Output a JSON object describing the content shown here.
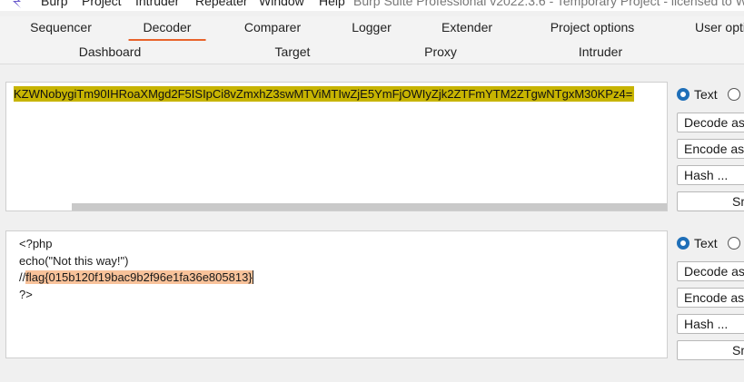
{
  "menubar": {
    "items": [
      "Burp",
      "Project",
      "Intruder",
      "Repeater",
      "Window",
      "Help"
    ],
    "window_title": "Burp Suite Professional v2022.3.6 - Temporary Project - licensed to W"
  },
  "tabs_row1": [
    "Sequencer",
    "Decoder",
    "Comparer",
    "Logger",
    "Extender",
    "Project options",
    "User opti"
  ],
  "tabs_row2": [
    "Dashboard",
    "Target",
    "Proxy",
    "Intruder"
  ],
  "selected_tab": "Decoder",
  "colors": {
    "accent": "#e8632b",
    "input_highlight": "#c7b401",
    "output_highlight": "#f8c29a",
    "radio": "#1f6fb8"
  },
  "panel1": {
    "content": "KZWNobygiTm90IHRoaXMgd2F5ISIpCi8vZmxhZ3swMTViMTIwZjE5YmFjOWIyZjk2ZTFmYTM2ZTgwNTgxM30KPz4="
  },
  "panel2": {
    "lines": [
      "<?php",
      "echo(\"Not this way!\")"
    ],
    "comment_prefix": "//",
    "flag": "flag{015b120f19bac9b2f96e1fa36e805813}",
    "last_line": "?>"
  },
  "controls1": {
    "radio_text": "Text",
    "decode_as": "Decode as ...",
    "encode_as": "Encode as ...",
    "hash": "Hash ...",
    "smart_decode": "Smart decode"
  },
  "controls2": {
    "radio_text": "Text",
    "decode_as": "Decode as ...",
    "encode_as": "Encode as ...",
    "hash": "Hash ...",
    "smart_decode": "Smart decode"
  }
}
